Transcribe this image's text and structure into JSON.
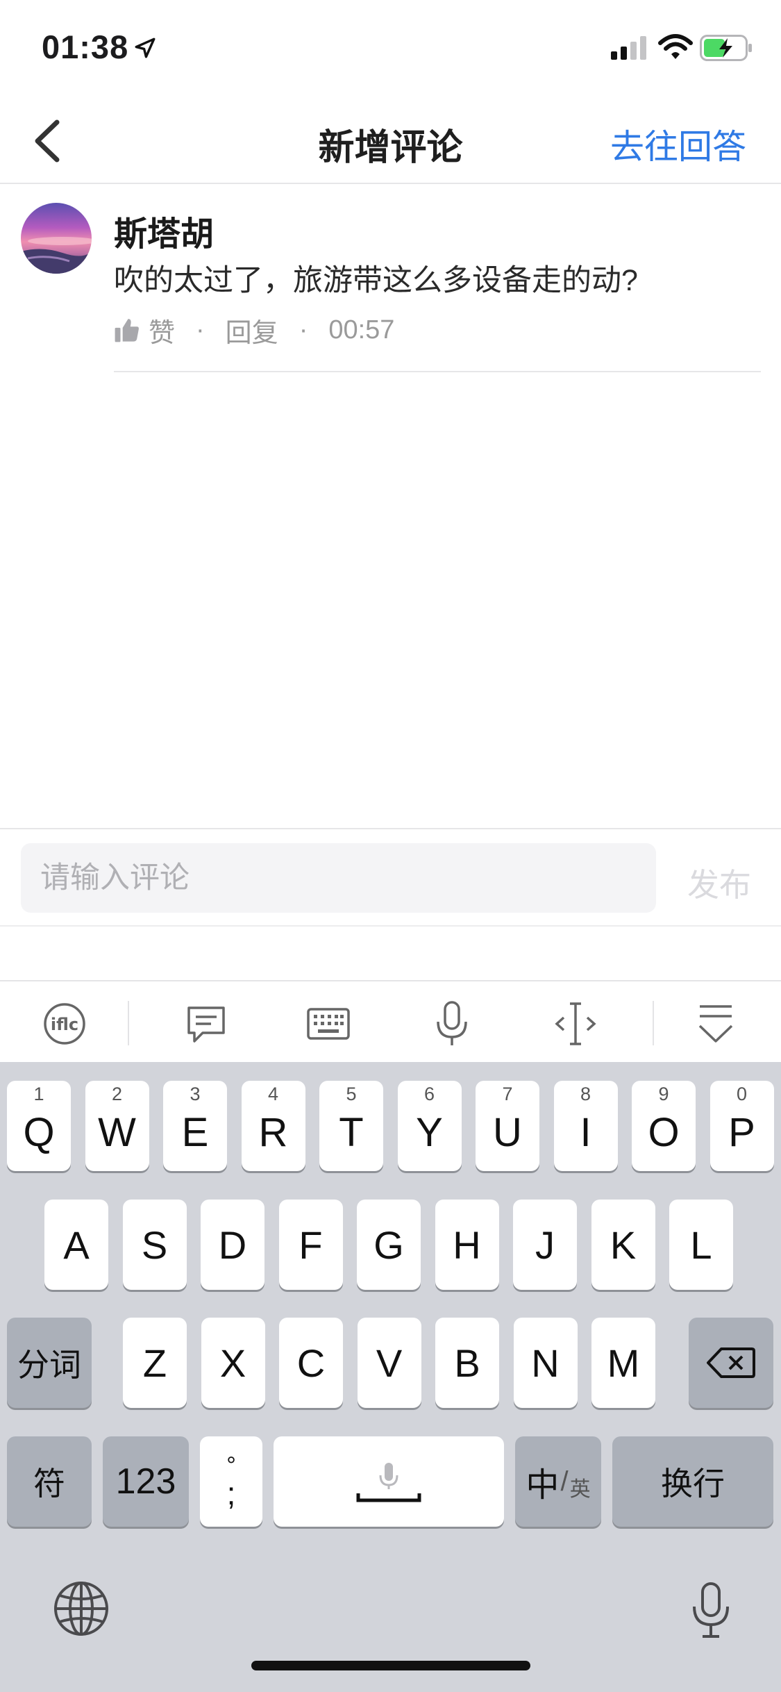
{
  "status": {
    "time": "01:38"
  },
  "nav": {
    "title": "新增评论",
    "action": "去往回答"
  },
  "comment": {
    "author": "斯塔胡",
    "text": "吹的太过了，旅游带这么多设备走的动?",
    "like_label": "赞",
    "reply_label": "回复",
    "time": "00:57",
    "separator": "·"
  },
  "input": {
    "placeholder": "请输入评论",
    "value": "",
    "publish_label": "发布"
  },
  "toolbar": {
    "icons": [
      "ifly-logo-icon",
      "comment-bubble-icon",
      "keyboard-icon",
      "microphone-icon",
      "cursor-icon",
      "collapse-keyboard-icon"
    ]
  },
  "keyboard": {
    "row1": [
      {
        "num": "1",
        "letter": "Q"
      },
      {
        "num": "2",
        "letter": "W"
      },
      {
        "num": "3",
        "letter": "E"
      },
      {
        "num": "4",
        "letter": "R"
      },
      {
        "num": "5",
        "letter": "T"
      },
      {
        "num": "6",
        "letter": "Y"
      },
      {
        "num": "7",
        "letter": "U"
      },
      {
        "num": "8",
        "letter": "I"
      },
      {
        "num": "9",
        "letter": "O"
      },
      {
        "num": "0",
        "letter": "P"
      }
    ],
    "row2": [
      "A",
      "S",
      "D",
      "F",
      "G",
      "H",
      "J",
      "K",
      "L"
    ],
    "row3": [
      "Z",
      "X",
      "C",
      "V",
      "B",
      "N",
      "M"
    ],
    "fenci": "分词",
    "fu": "符",
    "num_key": "123",
    "punct_top": "°",
    "punct_bottom": ";",
    "zh": "中",
    "en": "英",
    "enter": "换行"
  }
}
